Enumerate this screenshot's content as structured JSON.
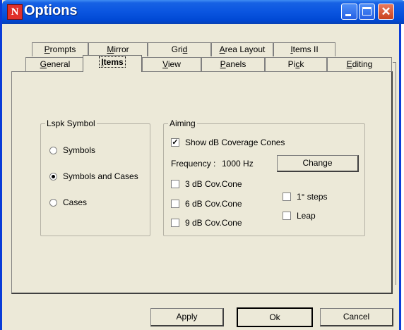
{
  "window": {
    "title": "Options",
    "app_icon": "app-logo-icon"
  },
  "title_buttons": {
    "minimize": "minimize-icon",
    "maximize": "maximize-icon",
    "close_glyph": "✕"
  },
  "tabs_back": [
    {
      "label_pre": "",
      "label_u": "P",
      "label_post": "rompts"
    },
    {
      "label_pre": "",
      "label_u": "M",
      "label_post": "irror"
    },
    {
      "label_pre": "Gri",
      "label_u": "d",
      "label_post": ""
    },
    {
      "label_pre": "",
      "label_u": "A",
      "label_post": "rea Layout"
    },
    {
      "label_pre": "",
      "label_u": "I",
      "label_post": "tems II"
    }
  ],
  "tabs_front": [
    {
      "label_pre": "",
      "label_u": "G",
      "label_post": "eneral"
    },
    {
      "label_pre": "",
      "label_u": "I",
      "label_post": "tems"
    },
    {
      "label_pre": "",
      "label_u": "V",
      "label_post": "iew"
    },
    {
      "label_pre": "",
      "label_u": "P",
      "label_post": "anels"
    },
    {
      "label_pre": "Pi",
      "label_u": "c",
      "label_post": "k"
    },
    {
      "label_pre": "",
      "label_u": "E",
      "label_post": "diting"
    }
  ],
  "lspk_symbol": {
    "legend": "Lspk Symbol",
    "options": [
      {
        "label": "Symbols",
        "selected": false
      },
      {
        "label": "Symbols and Cases",
        "selected": true
      },
      {
        "label": "Cases",
        "selected": false
      }
    ]
  },
  "aiming": {
    "legend": "Aiming",
    "show_cones": {
      "label": "Show dB Coverage Cones",
      "checked": true
    },
    "frequency_label": "Frequency :",
    "frequency_value": "1000 Hz",
    "change_button": "Change",
    "cones": [
      {
        "label": "3 dB Cov.Cone",
        "checked": false
      },
      {
        "label": "6 dB Cov.Cone",
        "checked": false
      },
      {
        "label": "9 dB Cov.Cone",
        "checked": false
      }
    ],
    "steps": {
      "label": "1° steps",
      "checked": false
    },
    "leap": {
      "label": "Leap",
      "checked": false
    }
  },
  "footer": {
    "apply": "Apply",
    "ok": "Ok",
    "cancel": "Cancel"
  }
}
